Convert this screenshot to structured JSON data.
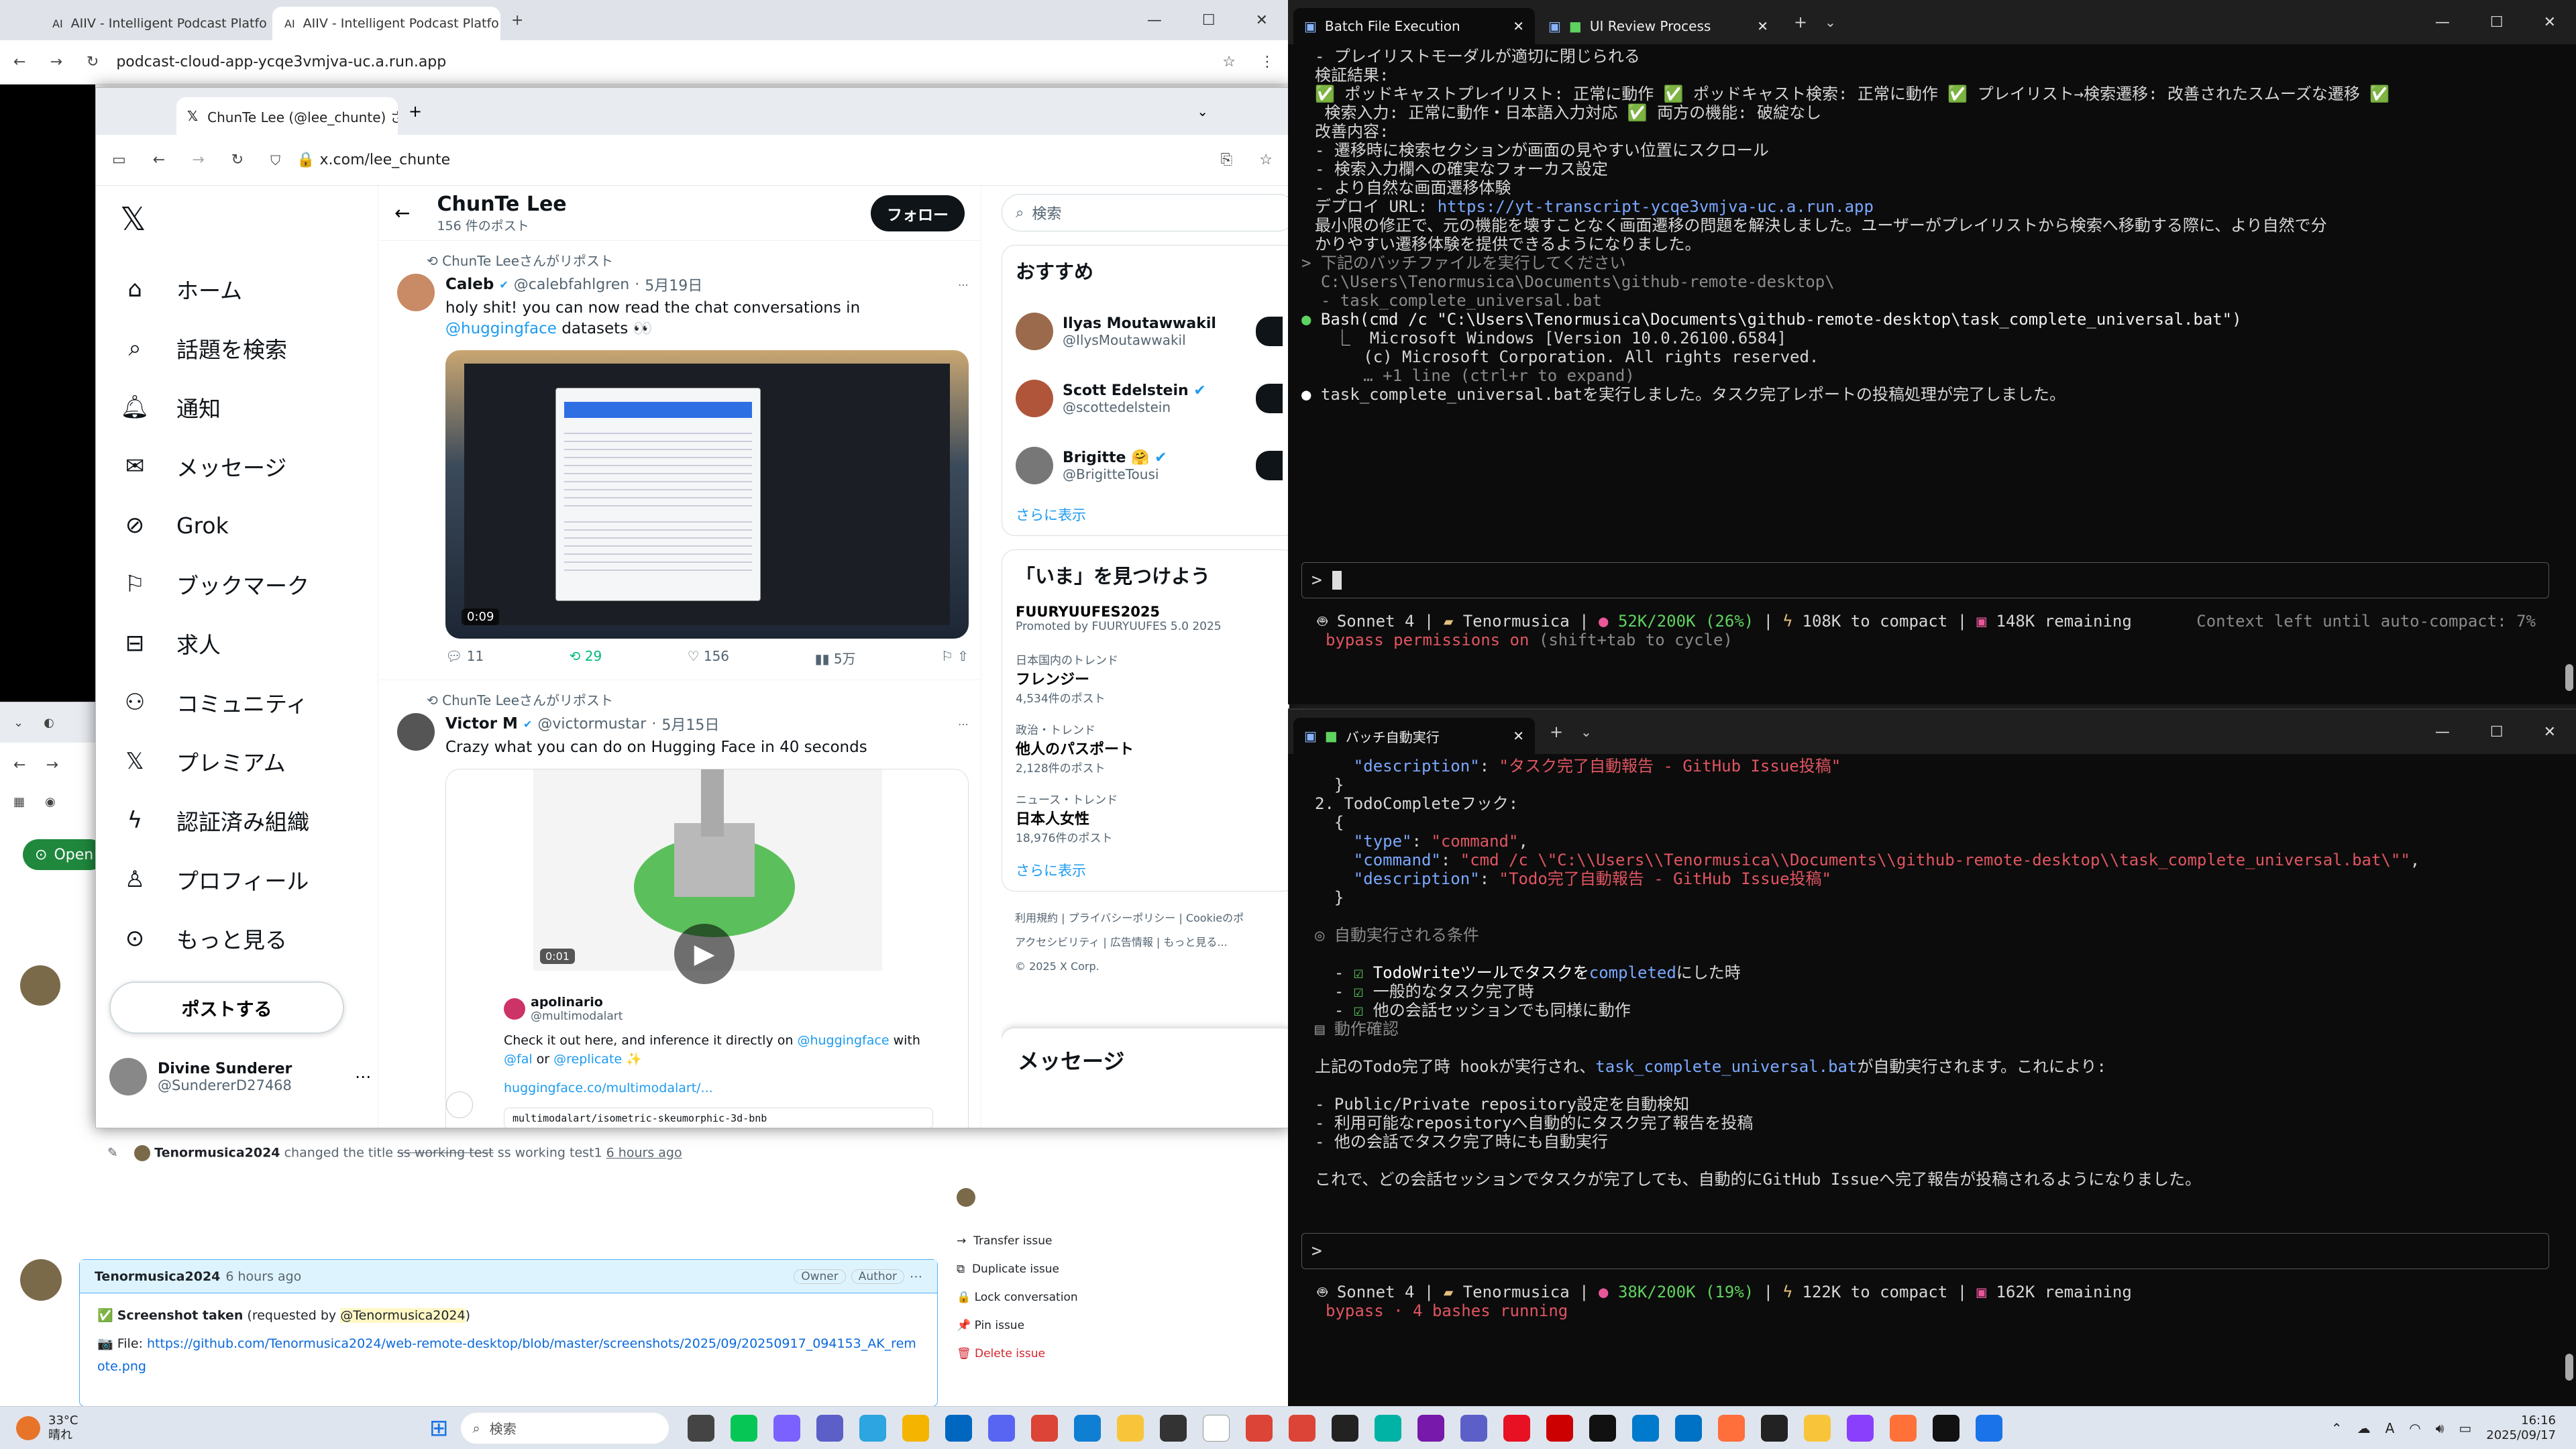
{
  "back_browser": {
    "tabs": [
      "AIIV - Intelligent Podcast Platfo",
      "AIIV - Intelligent Podcast Platfo"
    ],
    "url": "podcast-cloud-app-ycqe3vmjva-uc.a.run.app"
  },
  "github": {
    "open_label": "Open",
    "event_user": "Tenormusica2024",
    "event_text": "changed the title",
    "old_title": "ss working test",
    "new_title": "ss working test1",
    "event_time": "6 hours ago",
    "comment_user": "Tenormusica2024",
    "comment_time": "6 hours ago",
    "owner_badge": "Owner",
    "author_badge": "Author",
    "screenshot_line_pre": "Screenshot taken",
    "screenshot_requested": "(requested by",
    "screenshot_mention": "@Tenormusica2024",
    "file_label": "File:",
    "file_link": "https://github.com/Tenormusica2024/web-remote-desktop/blob/master/screenshots/2025/09/20250917_094153_AK_remote.png",
    "sidebar": [
      "Transfer issue",
      "Duplicate issue",
      "Lock conversation",
      "Pin issue",
      "Delete issue"
    ]
  },
  "xbrowser": {
    "tab_title": "ChunTe Lee (@lee_chunte) さん",
    "url": "x.com/lee_chunte",
    "nav": [
      "ホーム",
      "話題を検索",
      "通知",
      "メッセージ",
      "Grok",
      "ブックマーク",
      "求人",
      "コミュニティ",
      "プレミアム",
      "認証済み組織",
      "プロフィール",
      "もっと見る"
    ],
    "post_button": "ポストする",
    "user_name": "Divine Sunderer",
    "user_handle": "@SundererD27468",
    "profile_name": "ChunTe Lee",
    "profile_posts": "156 件のポスト",
    "follow": "フォロー",
    "tweets": [
      {
        "repost": "ChunTe Leeさんがリポスト",
        "name": "Caleb",
        "handle": "@calebfahlgren",
        "date": "5月19日",
        "text_pre": "holy shit! you can now read the chat conversations in",
        "text_link": "@huggingface",
        "text_post": "datasets 👀",
        "video_time": "0:09",
        "replies": "11",
        "reposts": "29",
        "likes": "156",
        "views": "5万"
      },
      {
        "repost": "ChunTe Leeさんがリポスト",
        "name": "Victor M",
        "handle": "@victormustar",
        "date": "5月15日",
        "text": "Crazy what you can do on Hugging Face in 40 seconds",
        "video_time": "0:01",
        "q_name": "apolinario",
        "q_handle": "@multimodalart",
        "q_text_pre": "Check it out here, and inference it directly on",
        "q_link1": "@huggingface",
        "q_mid": "with",
        "q_link2": "@fal",
        "q_or": "or",
        "q_link3": "@replicate",
        "q_link4": "huggingface.co/multimodalart/...",
        "q_card": "multimodalart/isometric-skeumorphic-3d-bnb"
      }
    ],
    "search_placeholder": "検索",
    "recommend_title": "おすすめ",
    "recommend": [
      {
        "name": "Ilyas Moutawwakil",
        "handle": "@IlysMoutawwakil"
      },
      {
        "name": "Scott Edelstein",
        "handle": "@scottedelstein"
      },
      {
        "name": "Brigitte 🤗",
        "handle": "@BrigitteTousi"
      }
    ],
    "more": "さらに表示",
    "trends_title": "「いま」を見つけよう",
    "trends": [
      {
        "cat": "FUURYUUFES2025",
        "name": "Promoted by FUURYUUFES 5.0 2025",
        "count": ""
      },
      {
        "cat": "日本国内のトレンド",
        "name": "フレンジー",
        "count": "4,534件のポスト"
      },
      {
        "cat": "政治・トレンド",
        "name": "他人のパスポート",
        "count": "2,128件のポスト"
      },
      {
        "cat": "ニュース・トレンド",
        "name": "日本人女性",
        "count": "18,976件のポスト"
      }
    ],
    "footer": [
      "利用規約",
      "プライバシーポリシー",
      "Cookieのポ",
      "アクセシビリティ",
      "広告情報",
      "もっと見る...",
      "© 2025 X Corp."
    ],
    "messages": "メッセージ"
  },
  "term1": {
    "tabs": [
      "Batch File Execution",
      "UI Review Process"
    ],
    "lines": [
      "- プレイリストモーダルが適切に閉じられる",
      "",
      "検証結果:",
      "✅ ポッドキャストプレイリスト: 正常に動作 ✅ ポッドキャスト検索: 正常に動作 ✅ プレイリスト→検索遷移: 改善されたスムーズな遷移 ✅",
      " 検索入力: 正常に動作・日本語入力対応 ✅ 両方の機能: 破綻なし",
      "",
      "改善内容:",
      "- 遷移時に検索セクションが画面の見やすい位置にスクロール",
      "- 検索入力欄への確実なフォーカス設定",
      "- より自然な画面遷移体験",
      ""
    ],
    "deploy_label": "デプロイ URL: ",
    "deploy_url": "https://yt-transcript-ycqe3vmjva-uc.a.run.app",
    "lines2": [
      "",
      "最小限の修正で、元の機能を壊すことなく画面遷移の問題を解決しました。ユーザーがプレイリストから検索へ移動する際に、より自然で分",
      "かりやすい遷移体験を提供できるようになりました。",
      ""
    ],
    "user_cmd": [
      "> 下記のバッチファイルを実行してください",
      "  C:\\Users\\Tenormusica\\Documents\\github-remote-desktop\\",
      "  - task_complete_universal.bat",
      ""
    ],
    "bash_line": "Bash(cmd /c \"C:\\Users\\Tenormusica\\Documents\\github-remote-desktop\\task_complete_universal.bat\")",
    "bash_out": [
      "  ⎿  Microsoft Windows [Version 10.0.26100.6584]",
      "     (c) Microsoft Corporation. All rights reserved.",
      "     … +1 line (ctrl+r to expand)",
      ""
    ],
    "result_line": "task_complete_universal.batを実行しました。タスク完了レポートの投稿処理が完了しました。",
    "status_model": "Sonnet 4",
    "status_user": "Tenormusica",
    "status_ctx": "52K/200K (26%)",
    "status_compact": "108K to compact",
    "status_remaining": "148K remaining",
    "status_right": "Context left until auto-compact: 7%",
    "bypass": "bypass permissions on",
    "bypass_hint": "(shift+tab to cycle)"
  },
  "term2": {
    "tabs": [
      "バッチ自動実行"
    ],
    "description1": "\"タスク完了自動報告 - GitHub Issue投稿\"",
    "hook_title": "2. TodoCompleteフック:",
    "type_val": "\"command\"",
    "command_val": "\"cmd /c \\\"C:\\\\Users\\\\Tenormusica\\\\Documents\\\\github-remote-desktop\\\\task_complete_universal.bat\\\"\"",
    "description2": "\"Todo完了自動報告 - GitHub Issue投稿\"",
    "cond_title": "自動実行される条件",
    "conds_pre": "TodoWriteツールでタスクを",
    "conds_kw": "completed",
    "conds_post": "にした時",
    "cond2": "一般的なタスク完了時",
    "cond3": "他の会話セッションでも同様に動作",
    "confirm_title": "動作確認",
    "para1_pre": "上記のTodo完了時 hookが実行され、",
    "para1_kw": "task_complete_universal.bat",
    "para1_post": "が自動実行されます。これにより:",
    "list": [
      "- Public/Private repository設定を自動検知",
      "- 利用可能なrepositoryへ自動的にタスク完了報告を投稿",
      "- 他の会話でタスク完了時にも自動実行"
    ],
    "para2": "これで、どの会話セッションでタスクが完了しても、自動的にGitHub Issueへ完了報告が投稿されるようになりました。",
    "status_model": "Sonnet 4",
    "status_user": "Tenormusica",
    "status_ctx": "38K/200K (19%)",
    "status_compact": "122K to compact",
    "status_remaining": "162K remaining",
    "bypass": "bypass",
    "bashes": "· 4 bashes running"
  },
  "taskbar": {
    "temp": "33°C",
    "weather": "晴れ",
    "search": "検索",
    "time": "16:16",
    "date": "2025/09/17"
  }
}
